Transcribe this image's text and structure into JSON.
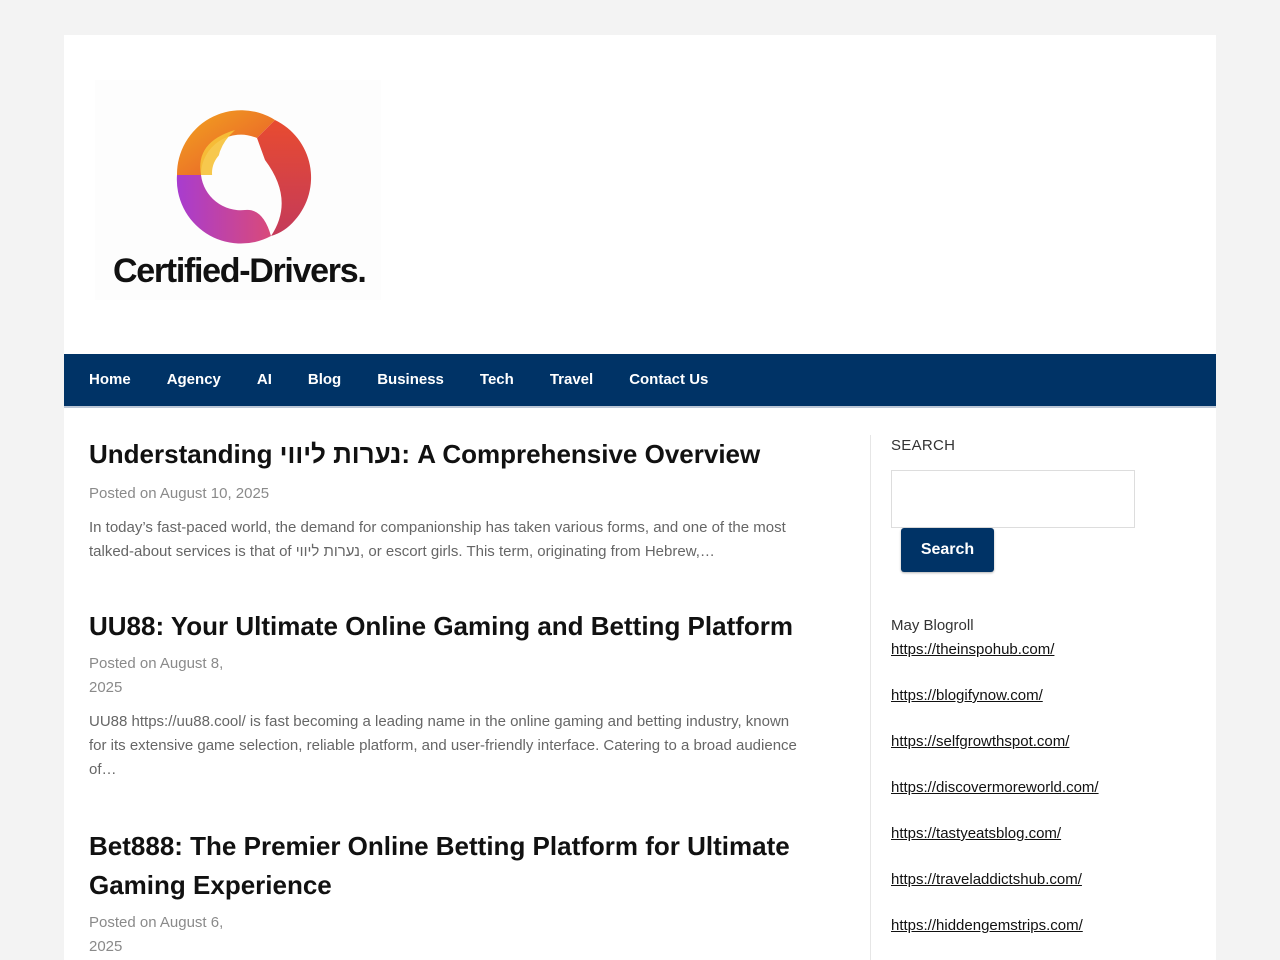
{
  "header": {
    "logo_text": "Certified-Drivers."
  },
  "nav": {
    "items": [
      "Home",
      "Agency",
      "AI",
      "Blog",
      "Business",
      "Tech",
      "Travel",
      "Contact Us"
    ]
  },
  "posts": [
    {
      "title": "Understanding נערות ליווי: A Comprehensive Overview",
      "meta": "Posted on August 10, 2025",
      "excerpt": "In today’s fast-paced world, the demand for companionship has taken various forms, and one of the most talked-about services is that of נערות ליווי, or escort girls. This term, originating from Hebrew,…"
    },
    {
      "title": "UU88: Your Ultimate Online Gaming and Betting Platform",
      "meta": "Posted on August 8, 2025",
      "excerpt": "UU88 https://uu88.cool/ is fast becoming a leading name in the online gaming and betting industry, known for its extensive game selection, reliable platform, and user-friendly interface. Catering to a broad audience of…"
    },
    {
      "title": "Bet888: The Premier Online Betting Platform for Ultimate Gaming Experience",
      "meta": "Posted on August 6, 2025",
      "excerpt": ""
    }
  ],
  "sidebar": {
    "search_title": "SEARCH",
    "search_button": "Search",
    "blogroll_title": "May Blogroll",
    "links": [
      "https://theinspohub.com/",
      "https://blogifynow.com/",
      "https://selfgrowthspot.com/",
      "https://discovermoreworld.com/",
      "https://tastyeatsblog.com/",
      "https://traveladdictshub.com/",
      "https://hiddengemstrips.com/"
    ]
  },
  "colors": {
    "nav_bg": "#003366",
    "page_bg": "#f3f3f3"
  }
}
